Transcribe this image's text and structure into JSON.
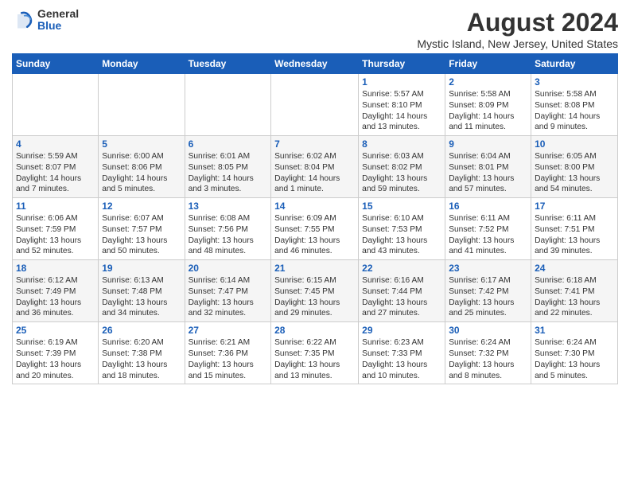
{
  "header": {
    "logo_general": "General",
    "logo_blue": "Blue",
    "title": "August 2024",
    "subtitle": "Mystic Island, New Jersey, United States"
  },
  "days_of_week": [
    "Sunday",
    "Monday",
    "Tuesday",
    "Wednesday",
    "Thursday",
    "Friday",
    "Saturday"
  ],
  "weeks": [
    [
      {
        "day": "",
        "info": ""
      },
      {
        "day": "",
        "info": ""
      },
      {
        "day": "",
        "info": ""
      },
      {
        "day": "",
        "info": ""
      },
      {
        "day": "1",
        "info": "Sunrise: 5:57 AM\nSunset: 8:10 PM\nDaylight: 14 hours\nand 13 minutes."
      },
      {
        "day": "2",
        "info": "Sunrise: 5:58 AM\nSunset: 8:09 PM\nDaylight: 14 hours\nand 11 minutes."
      },
      {
        "day": "3",
        "info": "Sunrise: 5:58 AM\nSunset: 8:08 PM\nDaylight: 14 hours\nand 9 minutes."
      }
    ],
    [
      {
        "day": "4",
        "info": "Sunrise: 5:59 AM\nSunset: 8:07 PM\nDaylight: 14 hours\nand 7 minutes."
      },
      {
        "day": "5",
        "info": "Sunrise: 6:00 AM\nSunset: 8:06 PM\nDaylight: 14 hours\nand 5 minutes."
      },
      {
        "day": "6",
        "info": "Sunrise: 6:01 AM\nSunset: 8:05 PM\nDaylight: 14 hours\nand 3 minutes."
      },
      {
        "day": "7",
        "info": "Sunrise: 6:02 AM\nSunset: 8:04 PM\nDaylight: 14 hours\nand 1 minute."
      },
      {
        "day": "8",
        "info": "Sunrise: 6:03 AM\nSunset: 8:02 PM\nDaylight: 13 hours\nand 59 minutes."
      },
      {
        "day": "9",
        "info": "Sunrise: 6:04 AM\nSunset: 8:01 PM\nDaylight: 13 hours\nand 57 minutes."
      },
      {
        "day": "10",
        "info": "Sunrise: 6:05 AM\nSunset: 8:00 PM\nDaylight: 13 hours\nand 54 minutes."
      }
    ],
    [
      {
        "day": "11",
        "info": "Sunrise: 6:06 AM\nSunset: 7:59 PM\nDaylight: 13 hours\nand 52 minutes."
      },
      {
        "day": "12",
        "info": "Sunrise: 6:07 AM\nSunset: 7:57 PM\nDaylight: 13 hours\nand 50 minutes."
      },
      {
        "day": "13",
        "info": "Sunrise: 6:08 AM\nSunset: 7:56 PM\nDaylight: 13 hours\nand 48 minutes."
      },
      {
        "day": "14",
        "info": "Sunrise: 6:09 AM\nSunset: 7:55 PM\nDaylight: 13 hours\nand 46 minutes."
      },
      {
        "day": "15",
        "info": "Sunrise: 6:10 AM\nSunset: 7:53 PM\nDaylight: 13 hours\nand 43 minutes."
      },
      {
        "day": "16",
        "info": "Sunrise: 6:11 AM\nSunset: 7:52 PM\nDaylight: 13 hours\nand 41 minutes."
      },
      {
        "day": "17",
        "info": "Sunrise: 6:11 AM\nSunset: 7:51 PM\nDaylight: 13 hours\nand 39 minutes."
      }
    ],
    [
      {
        "day": "18",
        "info": "Sunrise: 6:12 AM\nSunset: 7:49 PM\nDaylight: 13 hours\nand 36 minutes."
      },
      {
        "day": "19",
        "info": "Sunrise: 6:13 AM\nSunset: 7:48 PM\nDaylight: 13 hours\nand 34 minutes."
      },
      {
        "day": "20",
        "info": "Sunrise: 6:14 AM\nSunset: 7:47 PM\nDaylight: 13 hours\nand 32 minutes."
      },
      {
        "day": "21",
        "info": "Sunrise: 6:15 AM\nSunset: 7:45 PM\nDaylight: 13 hours\nand 29 minutes."
      },
      {
        "day": "22",
        "info": "Sunrise: 6:16 AM\nSunset: 7:44 PM\nDaylight: 13 hours\nand 27 minutes."
      },
      {
        "day": "23",
        "info": "Sunrise: 6:17 AM\nSunset: 7:42 PM\nDaylight: 13 hours\nand 25 minutes."
      },
      {
        "day": "24",
        "info": "Sunrise: 6:18 AM\nSunset: 7:41 PM\nDaylight: 13 hours\nand 22 minutes."
      }
    ],
    [
      {
        "day": "25",
        "info": "Sunrise: 6:19 AM\nSunset: 7:39 PM\nDaylight: 13 hours\nand 20 minutes."
      },
      {
        "day": "26",
        "info": "Sunrise: 6:20 AM\nSunset: 7:38 PM\nDaylight: 13 hours\nand 18 minutes."
      },
      {
        "day": "27",
        "info": "Sunrise: 6:21 AM\nSunset: 7:36 PM\nDaylight: 13 hours\nand 15 minutes."
      },
      {
        "day": "28",
        "info": "Sunrise: 6:22 AM\nSunset: 7:35 PM\nDaylight: 13 hours\nand 13 minutes."
      },
      {
        "day": "29",
        "info": "Sunrise: 6:23 AM\nSunset: 7:33 PM\nDaylight: 13 hours\nand 10 minutes."
      },
      {
        "day": "30",
        "info": "Sunrise: 6:24 AM\nSunset: 7:32 PM\nDaylight: 13 hours\nand 8 minutes."
      },
      {
        "day": "31",
        "info": "Sunrise: 6:24 AM\nSunset: 7:30 PM\nDaylight: 13 hours\nand 5 minutes."
      }
    ]
  ]
}
